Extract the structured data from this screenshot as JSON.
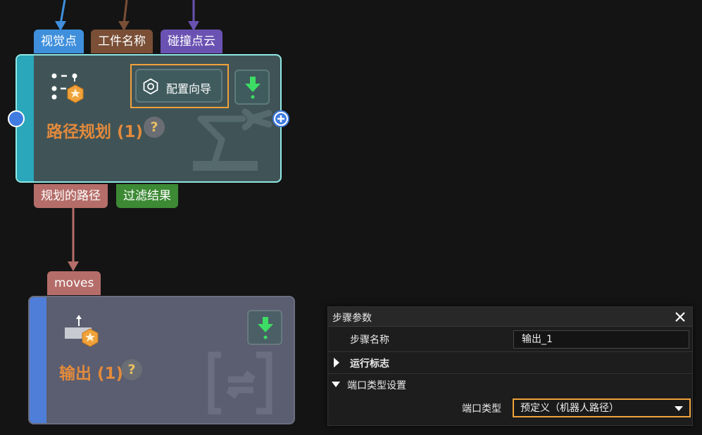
{
  "node_path": {
    "title": "路径规划",
    "count": "(1)",
    "help": "?",
    "config_wizard_label": "配置向导",
    "inputs": [
      {
        "label": "视觉点",
        "color": "#3f8fdc"
      },
      {
        "label": "工件名称",
        "color": "#7a4f36"
      },
      {
        "label": "碰撞点云",
        "color": "#6a52b2"
      }
    ],
    "outputs": [
      {
        "label": "规划的路径",
        "color": "#b56d69"
      },
      {
        "label": "过滤结果",
        "color": "#3c8a34"
      }
    ]
  },
  "node_output": {
    "title": "输出",
    "count": "(1)",
    "help": "?",
    "inputs": [
      {
        "label": "moves",
        "color": "#b56d69"
      }
    ]
  },
  "panel": {
    "title": "步骤参数",
    "step_name_label": "步骤名称",
    "step_name_value": "输出_1",
    "run_flags_label": "运行标志",
    "port_type_settings_label": "端口类型设置",
    "port_type_label": "端口类型",
    "port_type_value": "预定义（机器人路径）"
  },
  "colors": {
    "accent_orange": "#f0a23a",
    "node_path_bg": "#405457",
    "node_path_border": "#8fe8e4",
    "node_output_bg": "#5a5e70",
    "run_green": "#3ddc64"
  }
}
